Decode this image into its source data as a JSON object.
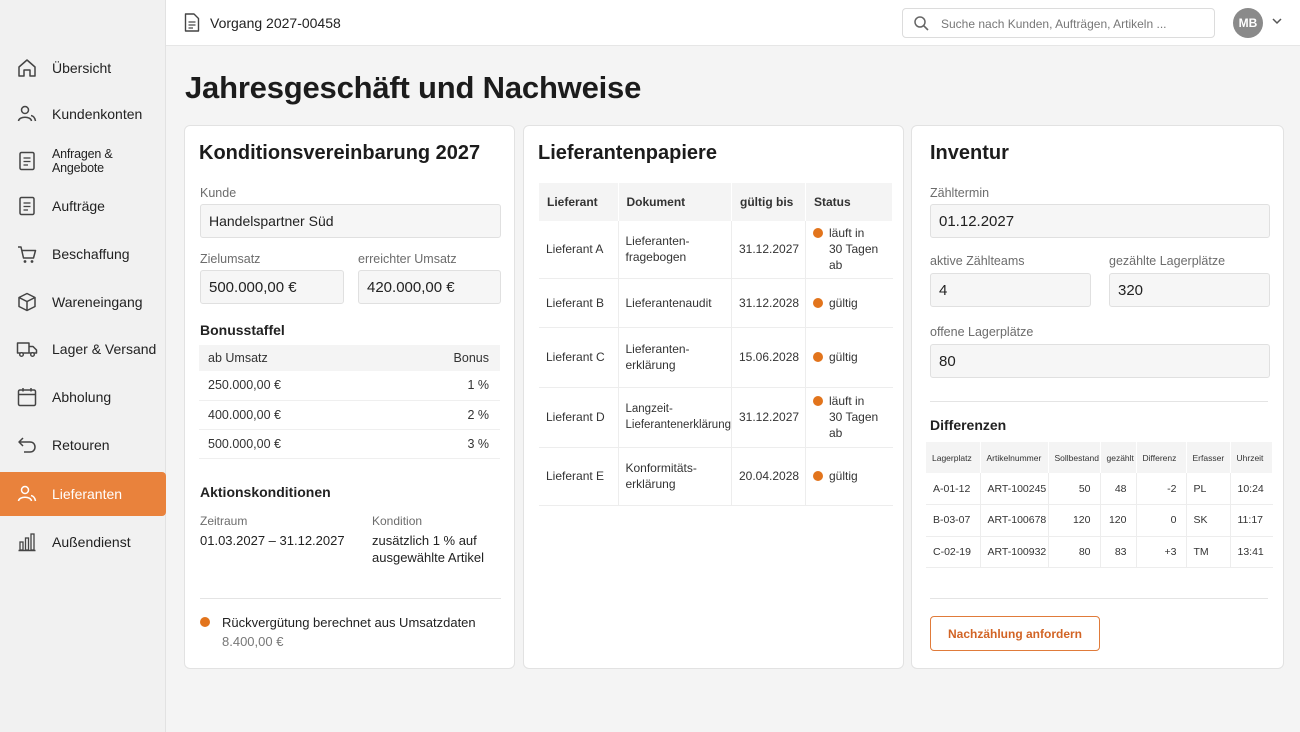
{
  "header": {
    "doc_title": "Vorgang 2027-00458",
    "search_placeholder": "Suche nach Kunden, Aufträgen, Artikeln ...",
    "avatar_initials": "MB"
  },
  "sidebar": {
    "items": [
      {
        "label": "Übersicht",
        "icon": "home-icon"
      },
      {
        "label": "Kundenkonten",
        "icon": "users-icon"
      },
      {
        "label": "Anfragen & Angebote",
        "icon": "document-icon"
      },
      {
        "label": "Aufträge",
        "icon": "document-icon"
      },
      {
        "label": "Beschaffung",
        "icon": "cart-icon"
      },
      {
        "label": "Wareneingang",
        "icon": "box-icon"
      },
      {
        "label": "Lager & Versand",
        "icon": "truck-icon"
      },
      {
        "label": "Abholung",
        "icon": "calendar-icon"
      },
      {
        "label": "Retouren",
        "icon": "return-icon"
      },
      {
        "label": "Lieferanten",
        "icon": "users-icon",
        "active": true
      },
      {
        "label": "Außendienst",
        "icon": "bar-chart-icon"
      }
    ]
  },
  "page": {
    "title": "Jahresgeschäft und Nachweise"
  },
  "conditions": {
    "title": "Konditionsvereinbarung 2027",
    "customer_label": "Kunde",
    "customer_value": "Handelspartner Süd",
    "target_label": "Zielumsatz",
    "target_value": "500.000,00 €",
    "achieved_label": "erreichter Umsatz",
    "achieved_value": "420.000,00 €",
    "bonus_title": "Bonusstaffel",
    "bonus_headers": [
      "ab Umsatz",
      "Bonus"
    ],
    "bonus_rows": [
      [
        "250.000,00 €",
        "1 %"
      ],
      [
        "400.000,00 €",
        "2 %"
      ],
      [
        "500.000,00 €",
        "3 %"
      ]
    ],
    "action_title": "Aktionskonditionen",
    "period_label": "Zeitraum",
    "period_value": "01.03.2027 – 31.12.2027",
    "condition_label": "Kondition",
    "condition_value_1": "zusätzlich 1 % auf",
    "condition_value_2": "ausgewählte Artikel",
    "refund_text": "Rückvergütung berechnet aus Umsatzdaten",
    "refund_value": "8.400,00 €",
    "status_color": "#e2741c"
  },
  "suppliers": {
    "title": "Lieferantenpapiere",
    "headers": [
      "Lieferant",
      "Dokument",
      "gültig bis",
      "Status"
    ],
    "rows": [
      {
        "supplier": "Lieferant A",
        "doc1": "Lieferanten-",
        "doc2": "fragebogen",
        "valid": "31.12.2027",
        "status1": "läuft in",
        "status2": "30 Tagen ab"
      },
      {
        "supplier": "Lieferant B",
        "doc1": "Lieferantenaudit",
        "doc2": "",
        "valid": "31.12.2028",
        "status1": "gültig",
        "status2": ""
      },
      {
        "supplier": "Lieferant C",
        "doc1": "Lieferanten-",
        "doc2": "erklärung",
        "valid": "15.06.2028",
        "status1": "gültig",
        "status2": ""
      },
      {
        "supplier": "Lieferant D",
        "doc1": "Langzeit-",
        "doc2": "Lieferantenerklärung",
        "valid": "31.12.2027",
        "status1": "läuft in",
        "status2": "30 Tagen ab"
      },
      {
        "supplier": "Lieferant E",
        "doc1": "Konformitäts-",
        "doc2": "erklärung",
        "valid": "20.04.2028",
        "status1": "gültig",
        "status2": ""
      }
    ]
  },
  "inventory": {
    "title": "Inventur",
    "date_label": "Zähltermin",
    "date_value": "01.12.2027",
    "teams_label": "aktive Zählteams",
    "teams_value": "4",
    "counted_label": "gezählte Lagerplätze",
    "counted_value": "320",
    "open_label": "offene Lagerplätze",
    "open_value": "80",
    "diff_title": "Differenzen",
    "diff_headers": [
      "Lagerplatz",
      "Artikelnummer",
      "Sollbestand",
      "gezählt",
      "Differenz",
      "Erfasser",
      "Uhrzeit"
    ],
    "diff_rows": [
      [
        "A-01-12",
        "ART-100245",
        "50",
        "48",
        "-2",
        "PL",
        "10:24"
      ],
      [
        "B-03-07",
        "ART-100678",
        "120",
        "120",
        "0",
        "SK",
        "11:17"
      ],
      [
        "C-02-19",
        "ART-100932",
        "80",
        "83",
        "+3",
        "TM",
        "13:41"
      ]
    ],
    "recount_button": "Nachzählung anfordern"
  }
}
